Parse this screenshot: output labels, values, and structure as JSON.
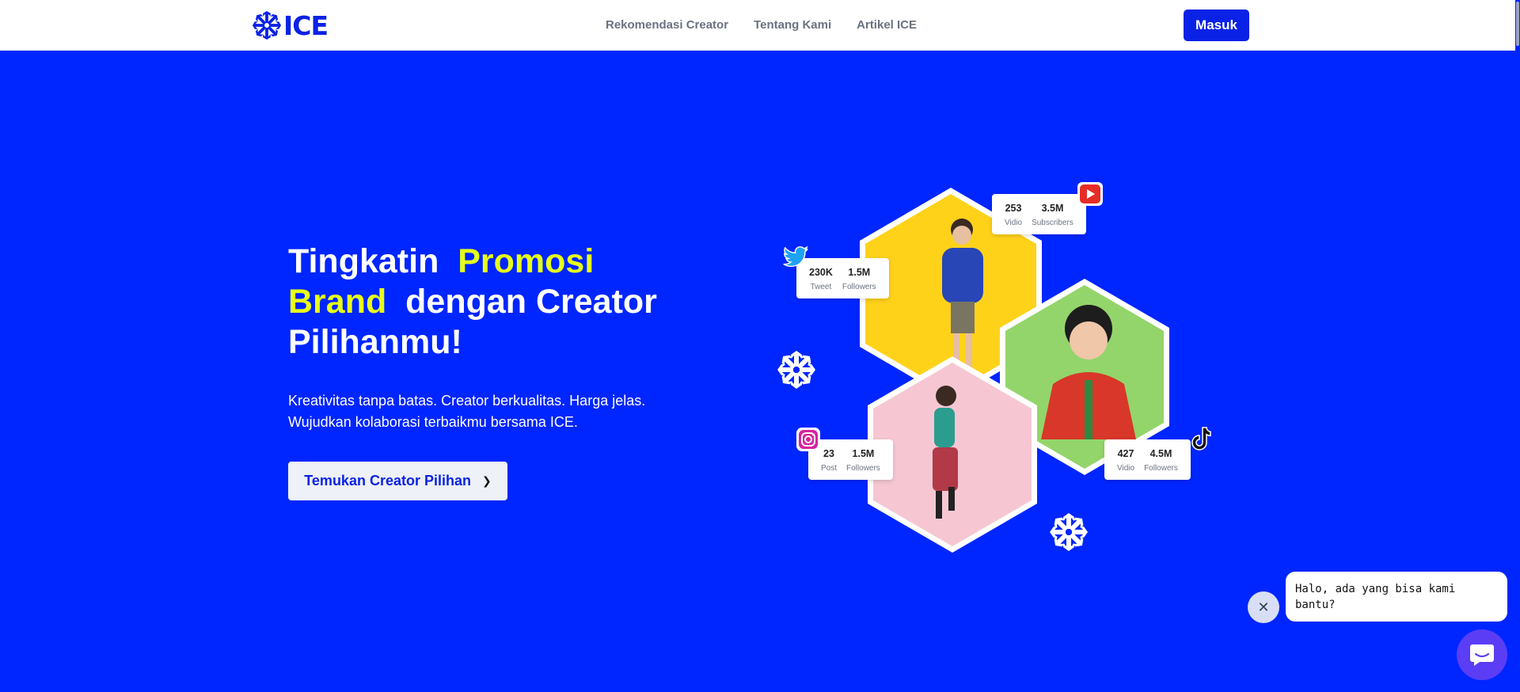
{
  "header": {
    "logo_text": "ICE",
    "nav": [
      "Rekomendasi Creator",
      "Tentang Kami",
      "Artikel ICE"
    ],
    "login_label": "Masuk"
  },
  "hero": {
    "title_part1": "Tingkatin",
    "title_highlight": "Promosi Brand",
    "title_part2": "dengan Creator Pilihanmu!",
    "title_highlight_a": "Promosi",
    "title_highlight_b": "Brand",
    "title_rest_line2": "dengan Creator",
    "title_line3": "Pilihanmu!",
    "description": "Kreativitas tanpa batas. Creator berkualitas. Harga jelas. Wujudkan kolaborasi terbaikmu bersama ICE.",
    "cta_label": "Temukan Creator Pilihan",
    "cta_icon": "chevron-right-icon"
  },
  "stats": {
    "youtube": {
      "icon": "youtube-icon",
      "a_num": "253",
      "a_lbl": "Vidio",
      "b_num": "3.5M",
      "b_lbl": "Subscribers"
    },
    "twitter": {
      "icon": "twitter-icon",
      "a_num": "230K",
      "a_lbl": "Tweet",
      "b_num": "1.5M",
      "b_lbl": "Followers"
    },
    "instagram": {
      "icon": "instagram-icon",
      "a_num": "23",
      "a_lbl": "Post",
      "b_num": "1.5M",
      "b_lbl": "Followers"
    },
    "tiktok": {
      "icon": "tiktok-icon",
      "a_num": "427",
      "a_lbl": "Vidio",
      "b_num": "4.5M",
      "b_lbl": "Followers"
    }
  },
  "chat": {
    "message": "Halo, ada yang bisa kami bantu?",
    "close_icon": "close-icon",
    "launcher_icon": "chat-icon"
  },
  "colors": {
    "brand_blue": "#0026ff",
    "highlight": "#e6ff1a",
    "hex_yellow": "#ffd21a",
    "hex_green": "#93d56a",
    "hex_pink": "#f6c7d3",
    "chat_purple": "#5b3df5"
  }
}
